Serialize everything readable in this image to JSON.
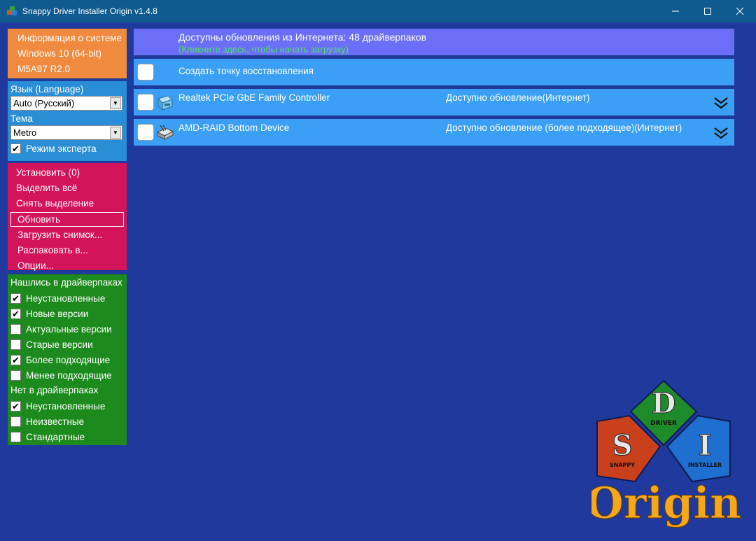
{
  "window": {
    "title": "Snappy Driver Installer Origin v1.4.8",
    "controls": {
      "minimize": "—",
      "maximize": "☐",
      "close": "✕"
    }
  },
  "sysinfo": {
    "label": "Информация о системе",
    "os": "Windows 10 (64-bit)",
    "board": "M5A97 R2.0"
  },
  "settings": {
    "language_label": "Язык (Language)",
    "language_value": "Auto (Русский)",
    "theme_label": "Тема",
    "theme_value": "Metro",
    "expert_mode": {
      "label": "Режим эксперта",
      "checked": true
    }
  },
  "actions": [
    {
      "label": "Установить (0)",
      "selected": false
    },
    {
      "label": "Выделить всё",
      "selected": false
    },
    {
      "label": "Снять выделение",
      "selected": false
    },
    {
      "label": "Обновить",
      "selected": true
    },
    {
      "label": "Загрузить снимок...",
      "selected": false
    },
    {
      "label": "Распаковать в...",
      "selected": false
    },
    {
      "label": "Опции...",
      "selected": false
    }
  ],
  "filters": {
    "found_header": "Нашлись в драйверпаках",
    "found": [
      {
        "label": "Неустановленные",
        "checked": true
      },
      {
        "label": "Новые версии",
        "checked": true
      },
      {
        "label": "Актуальные версии",
        "checked": false
      },
      {
        "label": "Старые версии",
        "checked": false
      },
      {
        "label": "Более подходящие",
        "checked": true
      },
      {
        "label": "Менее подходящие",
        "checked": false
      }
    ],
    "notfound_header": "Нет в драйверпаках",
    "notfound": [
      {
        "label": "Неустановленные",
        "checked": true
      },
      {
        "label": "Неизвестные",
        "checked": false
      },
      {
        "label": "Стандартные",
        "checked": false
      }
    ]
  },
  "main": {
    "updates_title": "Доступны обновления из Интернета: 48 драйверпаков",
    "updates_hint": "(Кликните здесь, чтобы начать загрузку)",
    "restore_point": "Создать точку восстановления",
    "devices": [
      {
        "name": "Realtek PCIe GbE Family Controller",
        "status": "Доступно обновление(Интернет)",
        "icon": "network-adapter-icon"
      },
      {
        "name": "AMD-RAID Bottom Device",
        "status": "Доступно обновление (более подходящее)(Интернет)",
        "icon": "storage-controller-icon"
      }
    ]
  },
  "logo": {
    "letters": [
      "S",
      "D",
      "I"
    ],
    "words": [
      "SNAPPY",
      "DRIVER",
      "INSTALLER"
    ],
    "origin": "Origin"
  },
  "colors": {
    "background": "#1f3a9c",
    "titlebar": "#0f5a8e",
    "sysinfo": "#f08a3e",
    "settings": "#2a8ed6",
    "actions": "#d4145a",
    "filters": "#1d8a1d",
    "row": "#3ba0f5",
    "updates_row": "#6b6ff7",
    "hint_text": "#4fe06a",
    "origin_text": "#f5a81c"
  }
}
